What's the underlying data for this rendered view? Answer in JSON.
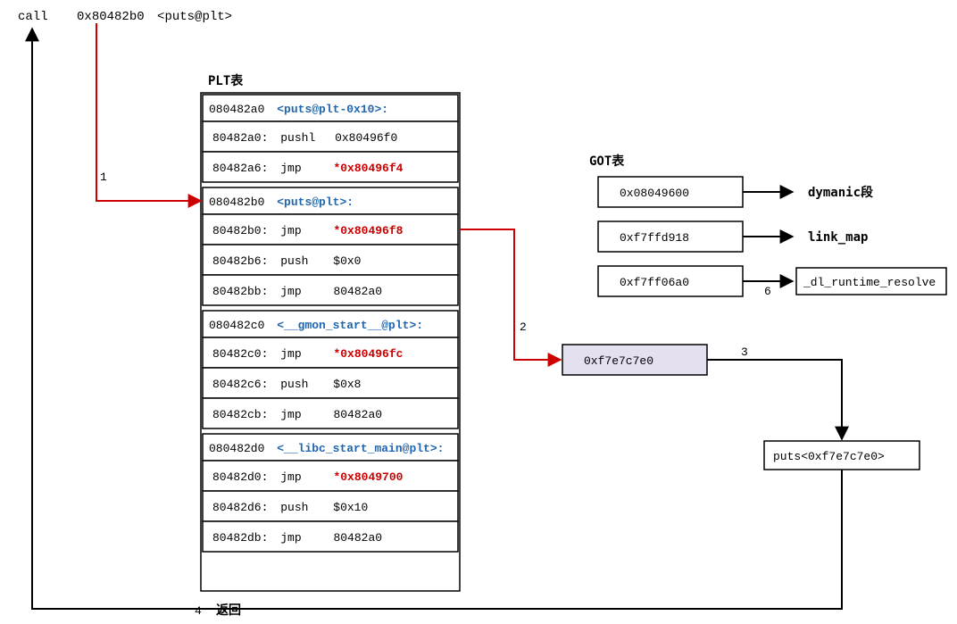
{
  "call_line": {
    "mnemonic": "call",
    "target_addr": "0x80482b0",
    "target_label": "<puts@plt>"
  },
  "plt": {
    "title": "PLT表",
    "entries": [
      {
        "header_addr": "080482a0",
        "header_label": "<puts@plt-0x10>:",
        "instrs": [
          {
            "addr": "80482a0:",
            "op": "pushl",
            "arg": "0x80496f0",
            "red": false
          },
          {
            "addr": "80482a6:",
            "op": "jmp",
            "arg": "*0x80496f4",
            "red": true
          }
        ]
      },
      {
        "header_addr": "080482b0",
        "header_label": "<puts@plt>:",
        "instrs": [
          {
            "addr": "80482b0:",
            "op": "jmp",
            "arg": "*0x80496f8",
            "red": true
          },
          {
            "addr": "80482b6:",
            "op": "push",
            "arg": "$0x0",
            "red": false
          },
          {
            "addr": "80482bb:",
            "op": "jmp",
            "arg": "80482a0",
            "red": false
          }
        ]
      },
      {
        "header_addr": "080482c0",
        "header_label": "<__gmon_start__@plt>:",
        "instrs": [
          {
            "addr": "80482c0:",
            "op": "jmp",
            "arg": "*0x80496fc",
            "red": true
          },
          {
            "addr": "80482c6:",
            "op": "push",
            "arg": "$0x8",
            "red": false
          },
          {
            "addr": "80482cb:",
            "op": "jmp",
            "arg": "80482a0",
            "red": false
          }
        ]
      },
      {
        "header_addr": "080482d0",
        "header_label": "<__libc_start_main@plt>:",
        "instrs": [
          {
            "addr": "80482d0:",
            "op": "jmp",
            "arg": "*0x8049700",
            "red": true
          },
          {
            "addr": "80482d6:",
            "op": "push",
            "arg": "$0x10",
            "red": false
          },
          {
            "addr": "80482db:",
            "op": "jmp",
            "arg": "80482a0",
            "red": false
          }
        ]
      }
    ]
  },
  "got": {
    "title": "GOT表",
    "rows": [
      {
        "value": "0x08049600",
        "desc": "dymanic段",
        "edge_label": ""
      },
      {
        "value": "0xf7ffd918",
        "desc": "link_map",
        "edge_label": ""
      },
      {
        "value": "0xf7ff06a0",
        "desc": "_dl_runtime_resolve",
        "edge_label": "6"
      }
    ],
    "target_box": "0xf7e7c7e0"
  },
  "resolved": {
    "label": "puts<0xf7e7c7e0>"
  },
  "edges": {
    "e1": "1",
    "e2": "2",
    "e3": "3",
    "e4_num": "4",
    "e4_text": "返回"
  }
}
